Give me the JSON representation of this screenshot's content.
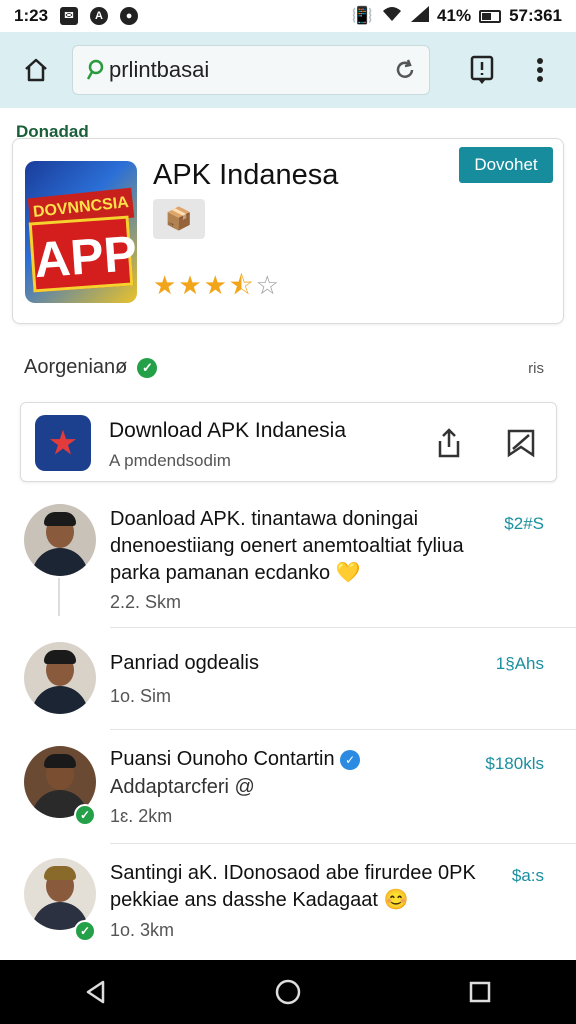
{
  "status": {
    "time": "1:23",
    "battery": "41%",
    "right_text": "57:361"
  },
  "browser": {
    "url": "prlintbasai"
  },
  "featured": {
    "section_header": "Donadad",
    "app_title": "APK Indanesa",
    "icon_ribbon_text": "DOVNNCSIA",
    "icon_big_text": "APP",
    "rating": 3.5,
    "rating_max": 5,
    "download_label": "Dovohet"
  },
  "section": {
    "title": "Aorgenianø",
    "right_text": "ris"
  },
  "download_card": {
    "title": "Download APK Indanesia",
    "subtitle": "A pmdendsodim"
  },
  "list": [
    {
      "text": "Doanload APK. tinantawa doningai dnenoestiiang oenert anemtoaltiat fyliua parka pamanan ecdanko 💛",
      "meta": "2.2. Skm",
      "price": "$2#S",
      "verified": false
    },
    {
      "text": "Panriad ogdealis",
      "meta": "1o. Sim",
      "price": "1§Ahs",
      "verified": false
    },
    {
      "text": "Puansi Ounoho Contartin",
      "subtext": "Addaptarcferi @",
      "meta": "1ɛ. 2km",
      "price": "$180kls",
      "verified": true
    },
    {
      "text": "Santingi aK. IDonosaod abe firurdee 0PK pekkiae ans dasshe Kadagaat 😊",
      "meta": "1o. 3km",
      "price": "$a:s",
      "verified": true
    }
  ],
  "colors": {
    "accent": "#178c9c",
    "browser_bar": "#dbeef2",
    "star": "#f2a51a",
    "verified": "#24a148"
  }
}
